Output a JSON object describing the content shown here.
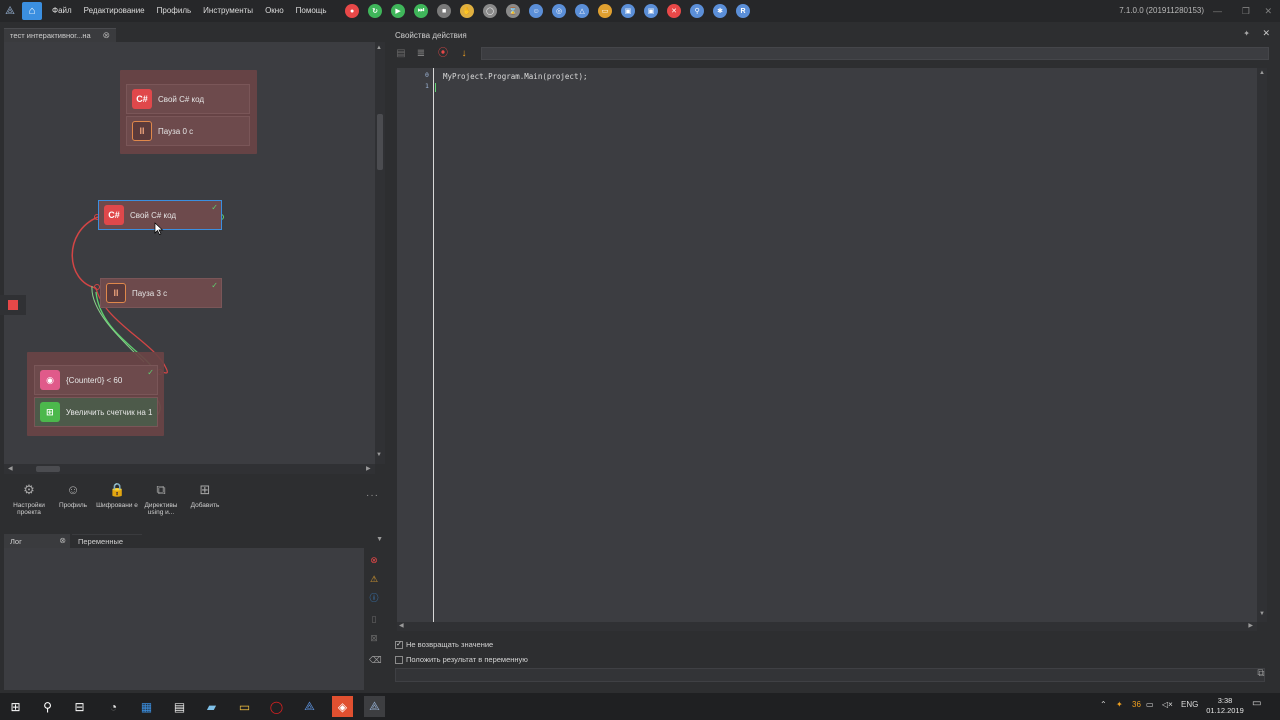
{
  "menubar": {
    "items": [
      "Файл",
      "Редактирование",
      "Профиль",
      "Инструменты",
      "Окно",
      "Помощь"
    ],
    "version": "7.1.0.0 (201911280153)",
    "toolbar_icons": [
      {
        "name": "record-icon",
        "color": "#e84848",
        "glyph": "●"
      },
      {
        "name": "refresh-icon",
        "color": "#3fb65a",
        "glyph": "↻"
      },
      {
        "name": "play-icon",
        "color": "#3fb65a",
        "glyph": "▶"
      },
      {
        "name": "step-icon",
        "color": "#3fb65a",
        "glyph": "⏭"
      },
      {
        "name": "stop-icon",
        "color": "#7a7a7a",
        "glyph": "■"
      },
      {
        "name": "hand-icon",
        "color": "#e0b040",
        "glyph": "✋"
      },
      {
        "name": "globe-icon",
        "color": "#8a8a8a",
        "glyph": "◯"
      },
      {
        "name": "hourglass-icon",
        "color": "#8a8a8a",
        "glyph": "⌛"
      },
      {
        "name": "user-icon",
        "color": "#5b8fd8",
        "glyph": "☺"
      },
      {
        "name": "visibility-icon",
        "color": "#5b8fd8",
        "glyph": "◎"
      },
      {
        "name": "triangle-icon",
        "color": "#5b8fd8",
        "glyph": "△"
      },
      {
        "name": "folder-icon",
        "color": "#e0a030",
        "glyph": "▭"
      },
      {
        "name": "save-icon",
        "color": "#5b8fd8",
        "glyph": "▣"
      },
      {
        "name": "save-as-icon",
        "color": "#5b8fd8",
        "glyph": "▣"
      },
      {
        "name": "close-icon",
        "color": "#e84848",
        "glyph": "✕"
      },
      {
        "name": "search-icon",
        "color": "#5b8fd8",
        "glyph": "⚲"
      },
      {
        "name": "settings-icon",
        "color": "#5b8fd8",
        "glyph": "✱"
      },
      {
        "name": "registry-icon",
        "color": "#5b8fd8",
        "glyph": "R"
      }
    ]
  },
  "editor_tab": {
    "title": "тест интерактивног...на"
  },
  "canvas": {
    "nodes": {
      "group1_csharp": {
        "icon": "C#",
        "label": "Свой C# код"
      },
      "group1_pause": {
        "icon": "II",
        "label": "Пауза 0 с"
      },
      "csharp": {
        "icon": "C#",
        "label": "Свой C# код"
      },
      "pause": {
        "icon": "II",
        "label": "Пауза 3 с"
      },
      "condition": {
        "label": "{Counter0} < 60"
      },
      "counter": {
        "label": "Увеличить счетчик на 1"
      }
    }
  },
  "canvas_tools": [
    {
      "name": "project-settings",
      "label": "Настройки проекта",
      "glyph": "⚙"
    },
    {
      "name": "profile",
      "label": "Профиль",
      "glyph": "☺"
    },
    {
      "name": "encryption",
      "label": "Шифровани е",
      "glyph": "🔒"
    },
    {
      "name": "using-directives",
      "label": "Директивы using и...",
      "glyph": "⧉"
    },
    {
      "name": "add",
      "label": "Добавить",
      "glyph": "⊞"
    }
  ],
  "log": {
    "tabs": [
      "Лог",
      "Переменные"
    ]
  },
  "properties": {
    "title": "Свойства действия",
    "line_numbers": [
      "0",
      "1"
    ],
    "code": "MyProject.Program.Main(project);",
    "no_return_label": "Не возвращать значение",
    "put_result_label": "Положить результат в переменную",
    "no_return_checked": true,
    "put_result_checked": false
  },
  "taskbar": {
    "tray_number": "36",
    "lang": "ENG",
    "time": "3:38",
    "date": "01.12.2019"
  }
}
